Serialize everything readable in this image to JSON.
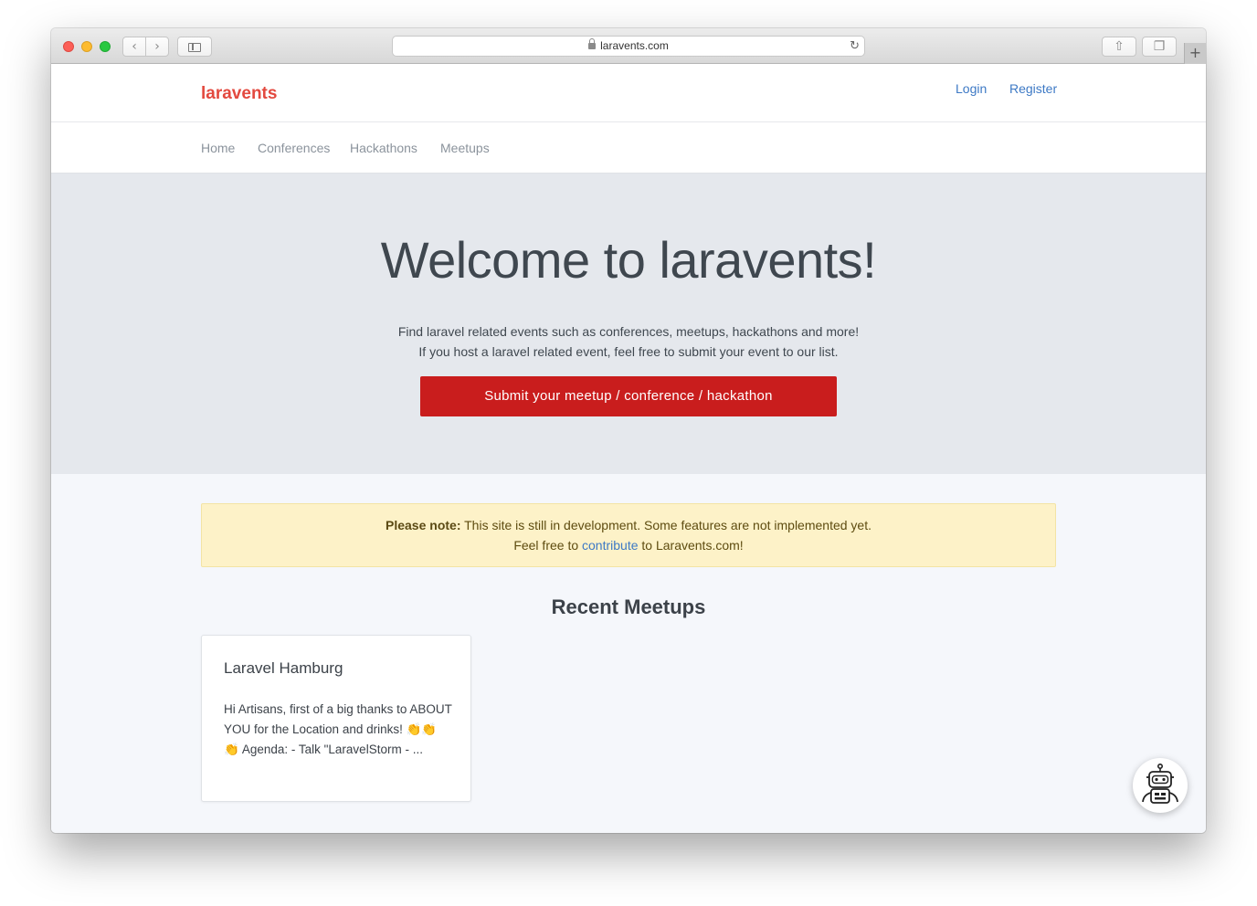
{
  "browser": {
    "url": "laravents.com",
    "new_tab_label": "+"
  },
  "header": {
    "brand": "laravents",
    "login": "Login",
    "register": "Register"
  },
  "subnav": {
    "items": [
      "Home",
      "Conferences",
      "Hackathons",
      "Meetups"
    ]
  },
  "hero": {
    "title": "Welcome to laravents!",
    "line1": "Find laravel related events such as conferences, meetups, hackathons and more!",
    "line2": "If you host a laravel related event, feel free to submit your event to our list.",
    "button": "Submit your meetup / conference / hackathon"
  },
  "notice": {
    "strong": "Please note:",
    "line1_rest": " This site is still in development. Some features are not implemented yet.",
    "line2_pre": "Feel free to ",
    "line2_link": "contribute",
    "line2_post": " to Laravents.com!"
  },
  "recent": {
    "title": "Recent Meetups",
    "cards": [
      {
        "title": "Laravel Hamburg",
        "text": "Hi Artisans, first of a big thanks to ABOUT YOU for the Location and drinks! 👏👏👏 Agenda: - Talk \"LaravelStorm - ..."
      }
    ]
  },
  "icons": {
    "back": "chevron-left-icon",
    "forward": "chevron-right-icon",
    "reload": "reload-icon",
    "share": "share-icon",
    "tabs": "tabs-icon",
    "chat": "robot-icon"
  },
  "colors": {
    "brand": "#e3493f",
    "cta": "#c91d1d",
    "link": "#3d79c5",
    "notice_bg": "#fdf2c8"
  }
}
